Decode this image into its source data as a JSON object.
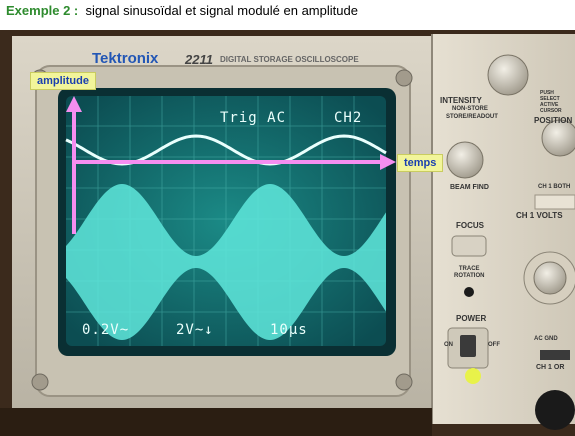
{
  "caption": {
    "prefix": "Exemple 2 :",
    "text": "signal sinusoïdal et signal modulé en amplitude"
  },
  "oscilloscope": {
    "brand": "Tektronix",
    "model": "2211",
    "model_subtitle": "DIGITAL STORAGE OSCILLOSCOPE",
    "screen": {
      "trig_label": "Trig AC",
      "channel_label": "CH2",
      "ch1_scale": "0.2V~",
      "ch2_scale": "2V~↓",
      "timebase": "10μs"
    },
    "panel": {
      "intensity": "INTENSITY",
      "non_store": "NON-STORE",
      "store_readout": "STORE/READOUT",
      "position": "POSITION",
      "beam_find": "BEAM FIND",
      "focus": "FOCUS",
      "trace_rotation": "TRACE\nROTATION",
      "power": "POWER",
      "on": "ON",
      "off": "OFF",
      "ch1_volts": "CH 1 VOLTS",
      "ch1_both": "CH 1 BOTH",
      "push_select": "PUSH\nSELECT\nACTIVE\nCURSOR",
      "ac_gnd": "AC  GND",
      "ch1_or": "CH 1 OR"
    },
    "power_led_color": "#e8f24a"
  },
  "annotations": {
    "amplitude_label": "amplitude",
    "time_label": "temps",
    "arrow_color": "#f58ef0"
  }
}
